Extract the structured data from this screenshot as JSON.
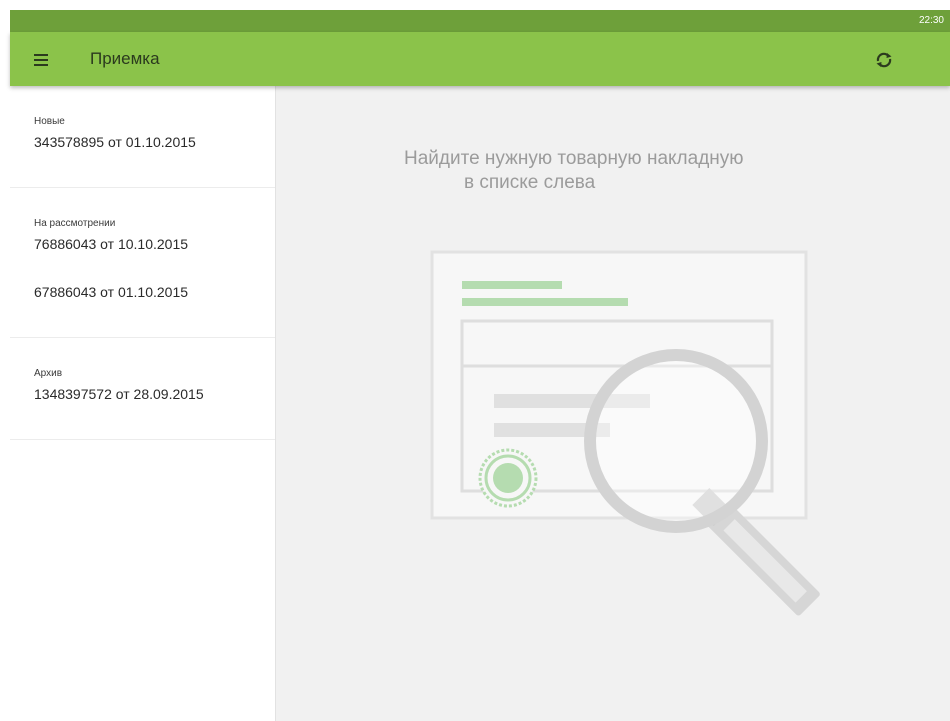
{
  "status_bar": {
    "time": "22:30"
  },
  "toolbar": {
    "title": "Приемка",
    "menu_icon": "hamburger-menu-icon",
    "refresh_icon": "sync-icon"
  },
  "sidebar": {
    "sections": [
      {
        "header": "Новые",
        "items": [
          "343578895 от 01.10.2015"
        ]
      },
      {
        "header": "На рассмотрении",
        "items": [
          "76886043 от 10.10.2015",
          "67886043 от 01.10.2015"
        ]
      },
      {
        "header": "Архив",
        "items": [
          "1348397572 от 28.09.2015"
        ]
      }
    ]
  },
  "content": {
    "message_line1": "Найдите нужную товарную накладную",
    "message_line2": "в списке слева",
    "illustration_icon": "document-magnifier-illustration"
  },
  "colors": {
    "status_bar": "#6ea03a",
    "toolbar": "#8bc34a",
    "accent_light": "#b5dcb0",
    "content_bg": "#f1f1f1"
  }
}
